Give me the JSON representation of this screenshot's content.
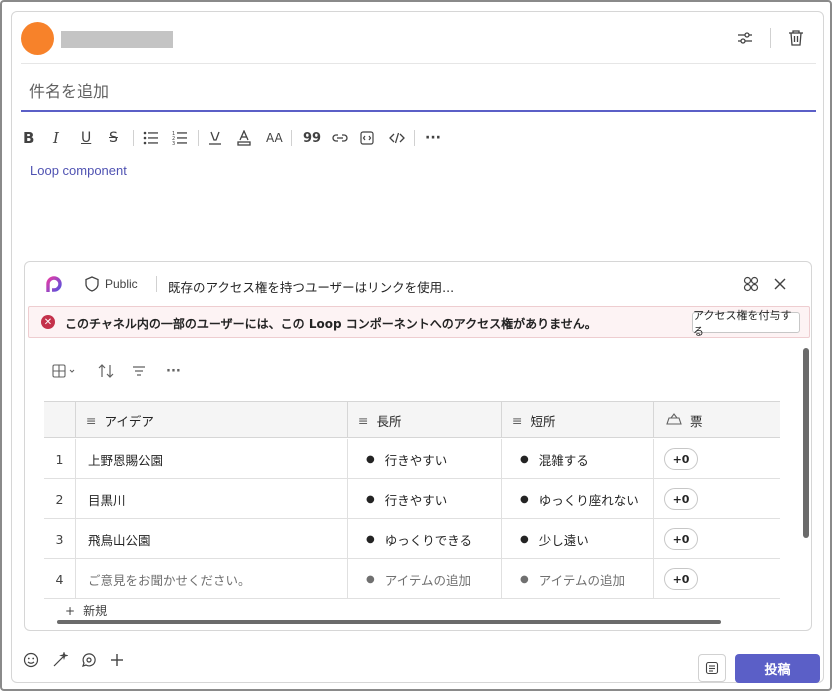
{
  "header": {
    "icons": [
      "settings-sliders-icon",
      "delete-icon"
    ]
  },
  "subject": {
    "placeholder": "件名を追加"
  },
  "toolbar": {
    "icons": [
      "bold-icon",
      "italic-icon",
      "underline-icon",
      "strikethrough-icon",
      "bullet-list-icon",
      "numbered-list-icon",
      "highlight-icon",
      "font-color-icon",
      "font-size-icon",
      "quote-icon",
      "link-icon",
      "code-snippet-icon",
      "code-icon",
      "more-icon"
    ],
    "bold": "B",
    "italic": "I",
    "underline": "U",
    "strike": "S",
    "quote": "99",
    "font_size": "AA",
    "more": "···"
  },
  "loop_link": "Loop component",
  "loop": {
    "visibility": "Public",
    "access_text": "既存のアクセス権を持つユーザーはリンクを使用...",
    "warning": "このチャネル内の一部のユーザーには、この Loop コンポーネントへのアクセス権がありません。",
    "grant_button": "アクセス権を付与する",
    "table_tools_more": "···",
    "columns": [
      "アイデア",
      "長所",
      "短所",
      "票"
    ],
    "rows": [
      {
        "num": "1",
        "idea": "上野恩賜公園",
        "pro": "行きやすい",
        "con": "混雑する",
        "vote": "+0"
      },
      {
        "num": "2",
        "idea": "目黒川",
        "pro": "行きやすい",
        "con": "ゆっくり座れない",
        "vote": "+0"
      },
      {
        "num": "3",
        "idea": "飛鳥山公園",
        "pro": "ゆっくりできる",
        "con": "少し遠い",
        "vote": "+0"
      },
      {
        "num": "4",
        "idea": "ご意見をお聞かせください。",
        "pro": "アイテムの追加",
        "con": "アイテムの追加",
        "vote": "+0"
      }
    ],
    "new_label": "新規"
  },
  "bottom": {
    "post_label": "投稿"
  },
  "colors": {
    "accent": "#5b5fc7",
    "avatar": "#f7822a",
    "error": "#c4314b"
  }
}
